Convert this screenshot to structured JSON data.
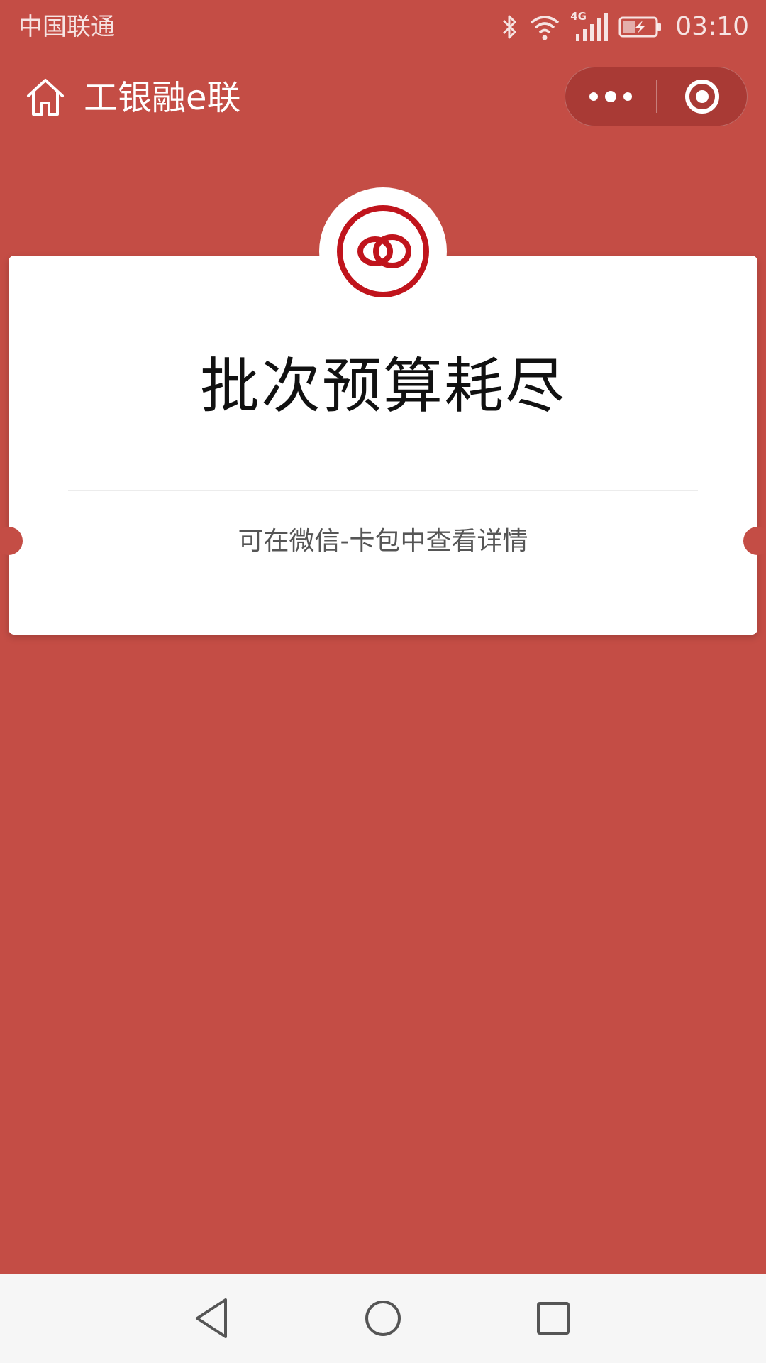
{
  "status_bar": {
    "carrier": "中国联通",
    "network": "4G",
    "time": "03:10",
    "icons": [
      "bluetooth-icon",
      "wifi-icon",
      "signal-icon",
      "battery-charging-icon"
    ]
  },
  "nav_bar": {
    "title": "工银融e联",
    "home_icon": "home-icon",
    "more_icon": "more-dots-icon",
    "close_icon": "target-close-icon"
  },
  "card": {
    "logo_icon": "icbc-rings-logo-icon",
    "title": "批次预算耗尽",
    "subtitle": "可在微信-卡包中查看详情"
  },
  "system_nav": {
    "icons": [
      "back-triangle-icon",
      "home-circle-icon",
      "recents-square-icon"
    ]
  },
  "colors": {
    "background": "#c44d45",
    "capsule": "#a93a35",
    "card": "#ffffff",
    "logo_red": "#c0141c",
    "system_nav": "#f6f6f6"
  }
}
